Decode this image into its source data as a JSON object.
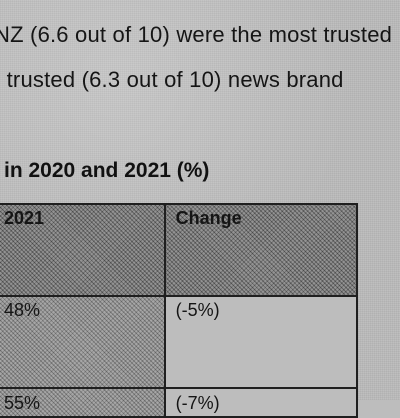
{
  "document": {
    "text_line_1": "NZ (6.6 out of 10) were the most trusted",
    "text_line_2": "t trusted (6.3 out of 10) news brand",
    "table_heading": "in 2020 and 2021 (%)"
  },
  "table": {
    "headers": [
      "2021",
      "Change"
    ],
    "rows": [
      [
        "48%",
        "(-5%)"
      ],
      [
        "55%",
        "(-7%)"
      ]
    ]
  }
}
